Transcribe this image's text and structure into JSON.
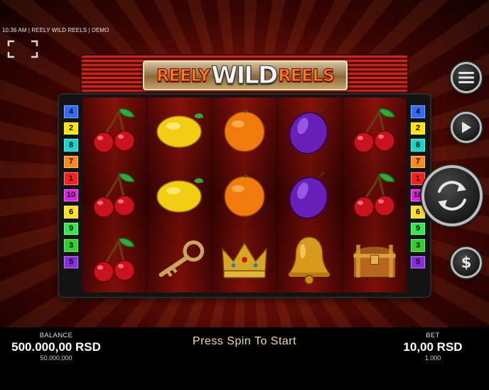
{
  "window": {
    "info_text": "10:36 AM | REELY WILD REELS | DEMO"
  },
  "logo": {
    "left": "REELY",
    "middle": "WILD",
    "right": "REELS"
  },
  "paylines": {
    "left": [
      {
        "number": "4",
        "color": "#2f6bff"
      },
      {
        "number": "2",
        "color": "#ffe600"
      },
      {
        "number": "8",
        "color": "#17d6c8"
      },
      {
        "number": "7",
        "color": "#ff8a1a"
      },
      {
        "number": "1",
        "color": "#ff1e1e"
      },
      {
        "number": "10",
        "color": "#e21ee0"
      },
      {
        "number": "6",
        "color": "#ffdf2a"
      },
      {
        "number": "9",
        "color": "#33e84a"
      },
      {
        "number": "3",
        "color": "#32d12c"
      },
      {
        "number": "5",
        "color": "#8a2be2"
      }
    ],
    "right": [
      {
        "number": "4",
        "color": "#2f6bff"
      },
      {
        "number": "2",
        "color": "#ffe600"
      },
      {
        "number": "8",
        "color": "#17d6c8"
      },
      {
        "number": "7",
        "color": "#ff8a1a"
      },
      {
        "number": "1",
        "color": "#ff1e1e"
      },
      {
        "number": "10",
        "color": "#e21ee0"
      },
      {
        "number": "6",
        "color": "#ffdf2a"
      },
      {
        "number": "9",
        "color": "#33e84a"
      },
      {
        "number": "3",
        "color": "#32d12c"
      },
      {
        "number": "5",
        "color": "#8a2be2"
      }
    ]
  },
  "reels": [
    [
      "cherry-icon",
      "cherry-icon",
      "cherry-icon"
    ],
    [
      "lemon-icon",
      "lemon-icon",
      "key-icon"
    ],
    [
      "orange-icon",
      "orange-icon",
      "crown-icon"
    ],
    [
      "plum-icon",
      "plum-icon",
      "bell-icon"
    ],
    [
      "cherry-icon",
      "cherry-icon",
      "chest-icon"
    ]
  ],
  "controls": {
    "menu_icon": "menu-icon",
    "autoplay_icon": "play-icon",
    "spin_icon": "spin-arrows-icon",
    "bet_icon": "dollar-icon",
    "fullscreen_icon": "fullscreen-icon"
  },
  "bottom": {
    "balance_label": "BALANCE",
    "balance_value": "500.000,00 RSD",
    "balance_sub": "50.000.000",
    "status": "Press Spin To Start",
    "bet_label": "BET",
    "bet_value": "10,00 RSD",
    "bet_sub": "1.000"
  }
}
